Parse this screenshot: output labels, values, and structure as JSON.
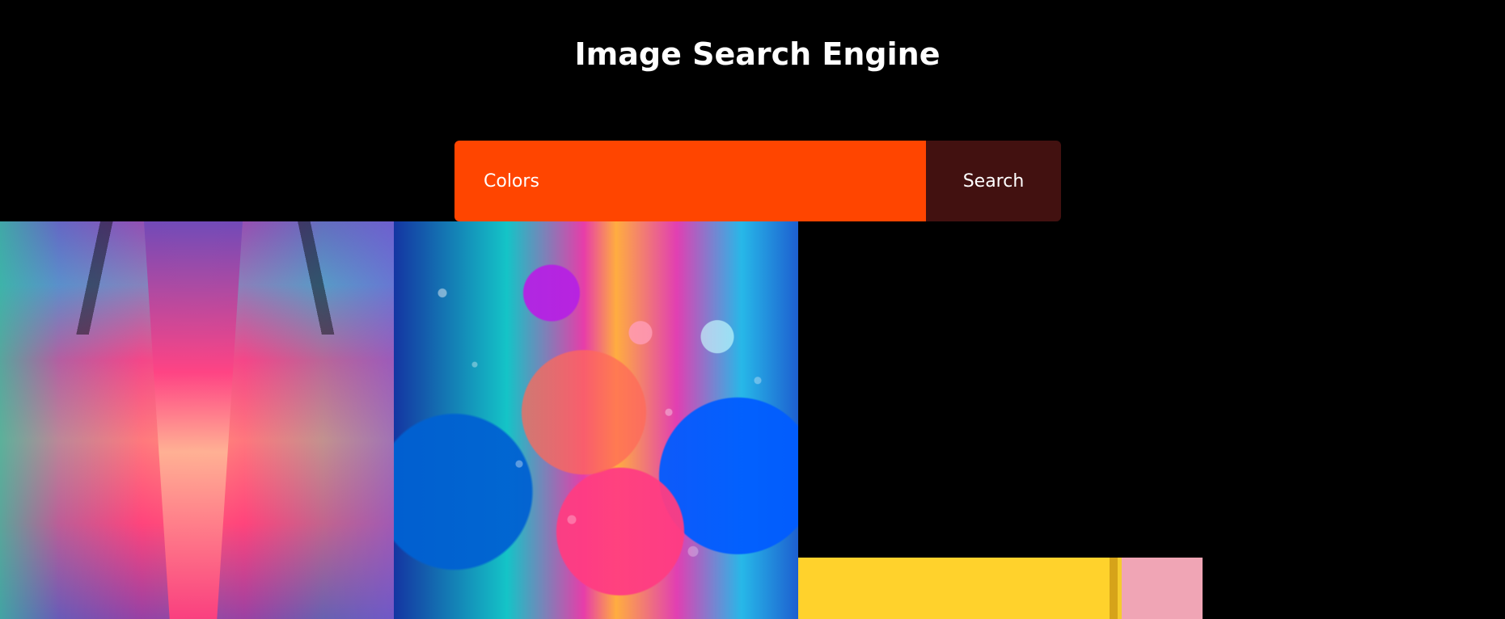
{
  "page": {
    "title": "Image Search Engine"
  },
  "search": {
    "value": "Colors",
    "button_label": "Search"
  },
  "results": {
    "images": [
      {
        "semantic": "colorful neon hallway image"
      },
      {
        "semantic": "colorful oil bubbles image"
      },
      {
        "semantic": "yellow wall image"
      }
    ]
  },
  "colors": {
    "background": "#000000",
    "search_input": "#ff4500",
    "search_button": "#421110",
    "text": "#ffffff"
  }
}
